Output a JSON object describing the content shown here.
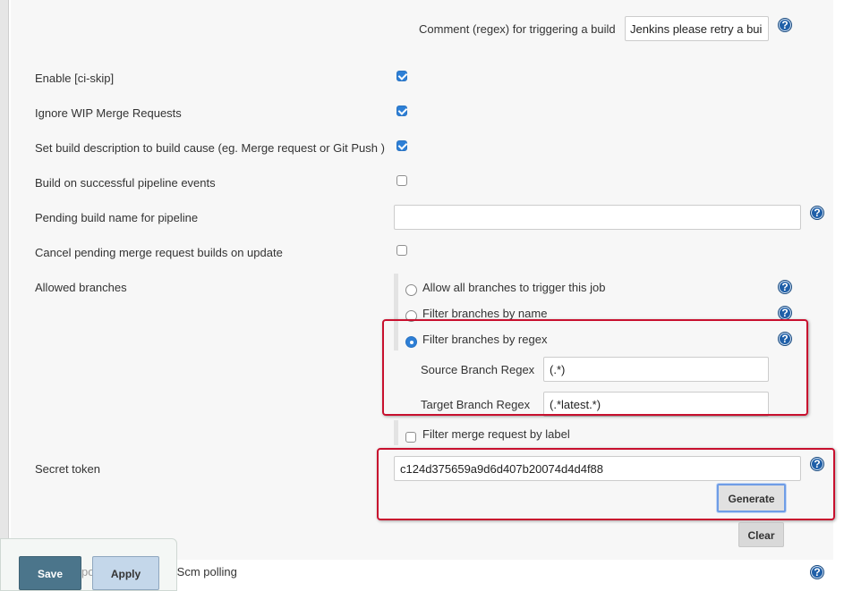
{
  "trigger_comment": {
    "label": "Comment (regex) for triggering a build",
    "value": "Jenkins please retry a buil"
  },
  "options": {
    "ci_skip": {
      "label": "Enable [ci-skip]",
      "checked": true
    },
    "ignore_wip": {
      "label": "Ignore WIP Merge Requests",
      "checked": true
    },
    "set_build_description": {
      "label": "Set build description to build cause (eg. Merge request or Git Push )",
      "checked": true
    },
    "build_on_pipeline": {
      "label": "Build on successful pipeline events",
      "checked": false
    },
    "pending_build_name": {
      "label": "Pending build name for pipeline",
      "value": ""
    },
    "cancel_pending": {
      "label": "Cancel pending merge request builds on update",
      "checked": false
    }
  },
  "allowed_branches": {
    "label": "Allowed branches",
    "choices": [
      {
        "label": "Allow all branches to trigger this job",
        "selected": false
      },
      {
        "label": "Filter branches by name",
        "selected": false
      },
      {
        "label": "Filter branches by regex",
        "selected": true
      }
    ],
    "source_regex": {
      "label": "Source Branch Regex",
      "value": "(.*)"
    },
    "target_regex": {
      "label": "Target Branch Regex",
      "value": "(.*latest.*)"
    },
    "filter_by_label": {
      "label": "Filter merge request by label",
      "checked": false
    }
  },
  "secret_token": {
    "label": "Secret token",
    "value": "c124d375659a9d6d407b20074d4d4f88",
    "generate_label": "Generate",
    "clear_label": "Clear"
  },
  "partial_row": {
    "label_fragment_left": "po",
    "label_fragment_right": "GITScm polling"
  },
  "footer": {
    "save_label": "Save",
    "apply_label": "Apply"
  },
  "help_icon_glyph": "?",
  "colors": {
    "highlight_box": "#c8102e",
    "checkbox_blue": "#2d7fd6",
    "help_icon": "#1f5fa8",
    "save_button": "#4b758b",
    "apply_button": "#c4d7ea"
  }
}
